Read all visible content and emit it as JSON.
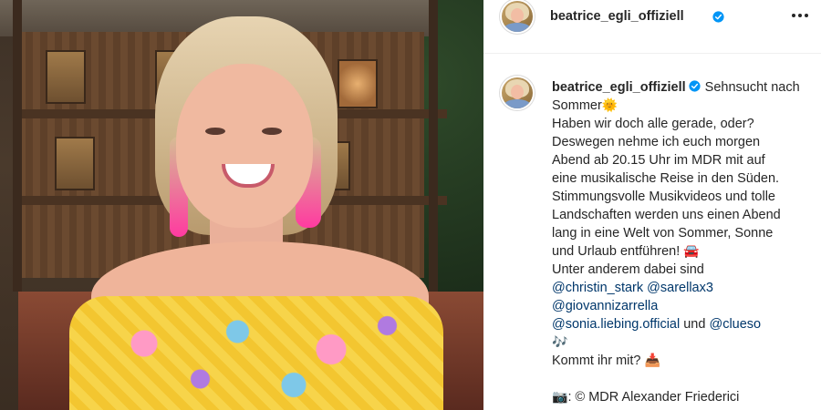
{
  "post": {
    "author": {
      "username": "beatrice_egli_offiziell",
      "verified": true
    },
    "caption": {
      "username": "beatrice_egli_offiziell",
      "first_line": "Sehnsucht nach Sommer",
      "body_lines": [
        "Haben wir doch alle gerade, oder?",
        "Deswegen nehme ich euch morgen",
        "Abend ab 20.15 Uhr im MDR mit auf",
        "eine musikalische Reise in den Süden.",
        "Stimmungsvolle Musikvideos und tolle",
        "Landschaften werden uns einen Abend",
        "lang in eine Welt von Sommer, Sonne",
        "und Urlaub entführen!"
      ],
      "mentions_intro": "Unter anderem dabei sind",
      "mentions": [
        "@christin_stark",
        "@sarellax3",
        "@giovannizarrella",
        "@sonia.liebing.official",
        "@clueso"
      ],
      "and_word": "und",
      "closing_question": "Kommt ihr mit?",
      "photo_credit": "© MDR Alexander Friederici"
    },
    "emoji": {
      "sun": "🌞",
      "car": "🚘",
      "notes": "🎶",
      "suitcase": "📥",
      "camera": "📷"
    },
    "colors": {
      "text": "#262626",
      "link": "#00376b",
      "verified": "#0095f6"
    },
    "icons": {
      "more": "more-horizontal-icon",
      "verified": "verified-badge-icon"
    }
  }
}
